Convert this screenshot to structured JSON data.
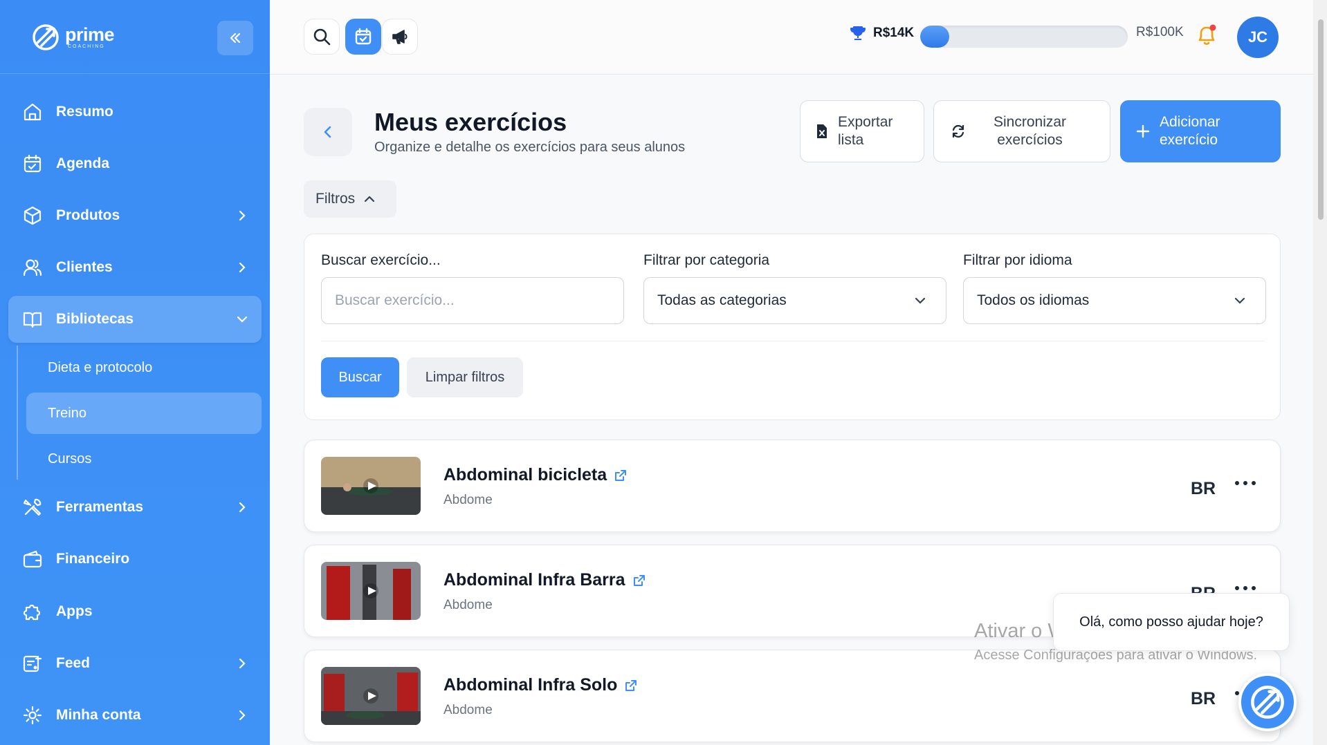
{
  "brand": {
    "name": "prime",
    "sub": "COACHING"
  },
  "sidebar": {
    "items": [
      {
        "label": "Resumo",
        "icon": "home-icon"
      },
      {
        "label": "Agenda",
        "icon": "calendar-icon"
      },
      {
        "label": "Produtos",
        "icon": "box-icon"
      },
      {
        "label": "Clientes",
        "icon": "users-icon"
      },
      {
        "label": "Bibliotecas",
        "icon": "book-icon"
      },
      {
        "label": "Ferramentas",
        "icon": "tools-icon"
      },
      {
        "label": "Financeiro",
        "icon": "wallet-icon"
      },
      {
        "label": "Apps",
        "icon": "puzzle-icon"
      },
      {
        "label": "Feed",
        "icon": "feed-icon"
      },
      {
        "label": "Minha conta",
        "icon": "gear-icon"
      }
    ],
    "sub_items": [
      {
        "label": "Dieta e protocolo"
      },
      {
        "label": "Treino"
      },
      {
        "label": "Cursos"
      }
    ]
  },
  "topbar": {
    "goal_current": "R$14K",
    "goal_target": "R$100K",
    "goal_progress": 0.14,
    "avatar_initials": "JC"
  },
  "page": {
    "title": "Meus exercícios",
    "subtitle": "Organize e detalhe os exercícios para seus alunos",
    "export": {
      "line1": "Exportar",
      "line2": "lista"
    },
    "sync": {
      "line1": "Sincronizar",
      "line2": "exercícios"
    },
    "add": {
      "line1": "Adicionar",
      "line2": "exercício"
    }
  },
  "filters": {
    "toggle_label": "Filtros",
    "search_label": "Buscar exercício...",
    "search_placeholder": "Buscar exercício...",
    "category_label": "Filtrar por categoria",
    "category_value": "Todas as categorias",
    "language_label": "Filtrar por idioma",
    "language_value": "Todos os idiomas",
    "search_button": "Buscar",
    "clear_button": "Limpar filtros"
  },
  "exercises": [
    {
      "name": "Abdominal bicicleta",
      "category": "Abdome",
      "lang": "BR"
    },
    {
      "name": "Abdominal Infra Barra",
      "category": "Abdome",
      "lang": "BR"
    },
    {
      "name": "Abdominal Infra Solo",
      "category": "Abdome",
      "lang": "BR"
    }
  ],
  "overlay": {
    "watermark_title": "Ativar o Windows",
    "watermark_sub": "Acesse Configurações para ativar o Windows.",
    "chat_message": "Olá, como posso ajudar hoje?"
  },
  "colors": {
    "primary": "#3f8ff6",
    "sidebar": "#3b8cf5",
    "notification": "#ef4444",
    "trophy": "#2563eb"
  }
}
